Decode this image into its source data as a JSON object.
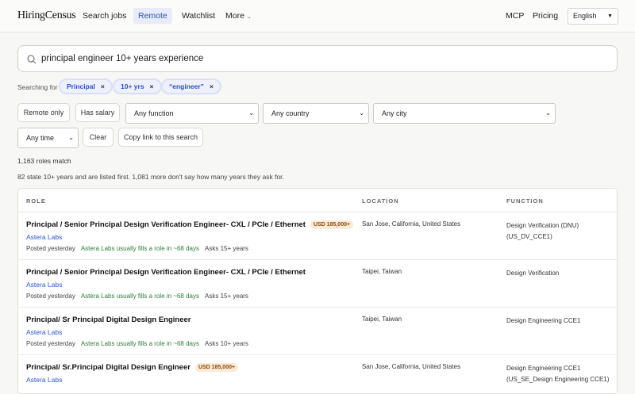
{
  "header": {
    "logo": "HiringCensus",
    "nav": [
      "Search jobs",
      "Remote",
      "Watchlist",
      "More"
    ],
    "right": [
      "MCP",
      "Pricing"
    ],
    "language": "English"
  },
  "search": {
    "query": "principal engineer 10+ years experience"
  },
  "chips": {
    "label": "Searching for",
    "items": [
      "Principal",
      "10+ yrs",
      "“engineer”"
    ]
  },
  "filters": {
    "remote_only": "Remote only",
    "has_salary": "Has salary",
    "function": "Any function",
    "country": "Any country",
    "city": "Any city",
    "time": "Any time",
    "clear": "Clear",
    "copy_link": "Copy link to this search"
  },
  "results": {
    "count": "1,163 roles match",
    "note": "82 state 10+ years and are listed first. 1,081 more don't say how many years they ask for."
  },
  "table": {
    "headers": [
      "ROLE",
      "LOCATION",
      "FUNCTION"
    ],
    "rows": [
      {
        "title": "Principal / Senior Principal Design Verification Engineer- CXL / PCIe / Ethernet",
        "salary": "USD 185,000+",
        "company": "Astera Labs",
        "posted": "Posted yesterday",
        "fill": "Astera Labs usually fills a role in ~68 days",
        "asks": "Asks 15+ years",
        "location": "San Jose, California, United States",
        "function1": "Design Verification (DNU)",
        "function2": "(US_DV_CCE1)"
      },
      {
        "title": "Principal / Senior Principal Design Verification Engineer- CXL / PCIe / Ethernet",
        "salary": "",
        "company": "Astera Labs",
        "posted": "Posted yesterday",
        "fill": "Astera Labs usually fills a role in ~68 days",
        "asks": "Asks 15+ years",
        "location": "Taipei, Taiwan",
        "function1": "Design Verification",
        "function2": ""
      },
      {
        "title": "Principal/ Sr Principal Digital Design Engineer",
        "salary": "",
        "company": "Astera Labs",
        "posted": "Posted yesterday",
        "fill": "Astera Labs usually fills a role in ~68 days",
        "asks": "Asks 10+ years",
        "location": "Taipei, Taiwan",
        "function1": "Design Engineering CCE1",
        "function2": ""
      },
      {
        "title": "Principal/ Sr.Principal Digital Design Engineer",
        "salary": "USD 185,000+",
        "company": "Astera Labs",
        "posted": "",
        "fill": "",
        "asks": "",
        "location": "San Jose, California, United States",
        "function1": "Design Engineering CCE1",
        "function2": "(US_SE_Design Engineering CCE1)"
      }
    ]
  }
}
